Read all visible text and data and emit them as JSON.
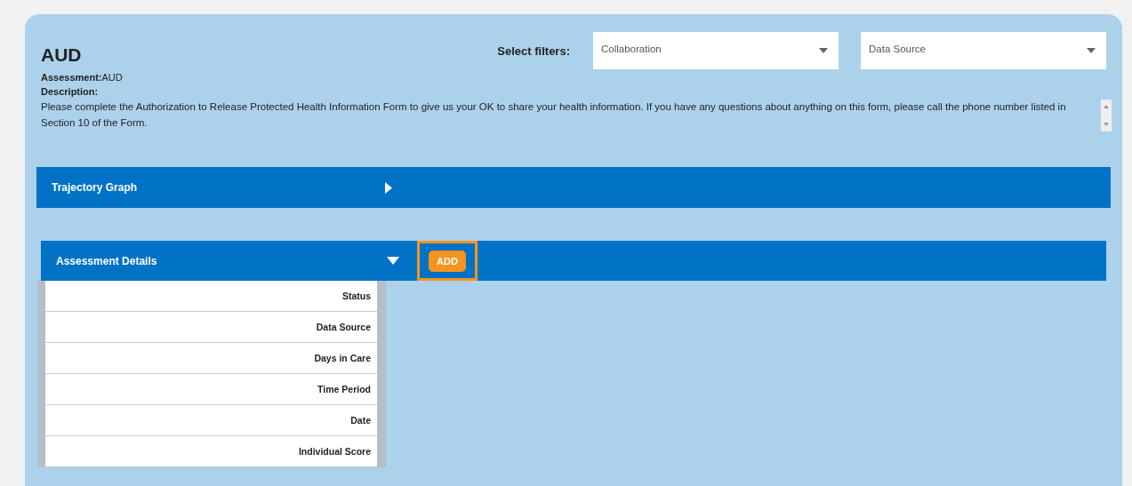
{
  "title": "AUD",
  "assessment": {
    "label": "Assessment:",
    "value": "AUD"
  },
  "description": {
    "label": "Description:",
    "text": "Please complete the Authorization to Release Protected Health Information Form to give us your OK to share your health information. If you have any questions about anything on this form, please call the phone number listed in Section 10 of the Form."
  },
  "filters": {
    "label": "Select filters:",
    "dropdowns": [
      {
        "placeholder": "Collaboration"
      },
      {
        "placeholder": "Data Source"
      }
    ]
  },
  "panels": [
    {
      "title": "Trajectory Graph",
      "expanded": false
    },
    {
      "title": "Assessment Details",
      "expanded": true,
      "add_button": "ADD",
      "rows": [
        "Status",
        "Data Source",
        "Days in Care",
        "Time Period",
        "Date",
        "Individual Score"
      ]
    }
  ]
}
